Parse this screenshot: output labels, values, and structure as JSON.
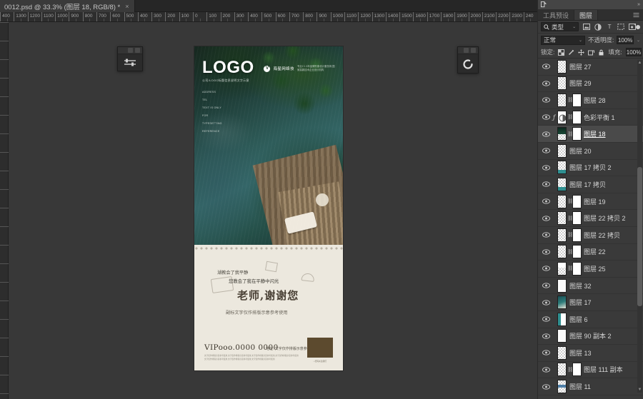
{
  "window": {
    "document_tab": {
      "title": "0012.psd @ 33.3% (图层 18, RGB/8) *",
      "close_label": "×"
    }
  },
  "rulers": {
    "horizontal_labels": [
      "400",
      "1300",
      "1200",
      "1100",
      "1000",
      "900",
      "800",
      "700",
      "600",
      "500",
      "400",
      "300",
      "200",
      "100",
      "0",
      "100",
      "200",
      "300",
      "400",
      "500",
      "600",
      "700",
      "800",
      "900",
      "1000",
      "1100",
      "1200",
      "1300",
      "1400",
      "1500",
      "1600",
      "1700",
      "1800",
      "1900",
      "2000",
      "2100",
      "2200",
      "2300",
      "240"
    ]
  },
  "floating_panels": [
    {
      "name": "adjustments-mini-panel",
      "icon": "sliders-icon",
      "min_label": "▬",
      "close_label": "▣"
    },
    {
      "name": "loading-mini-panel",
      "icon": "spinner-icon",
      "min_label": "▬",
      "close_label": "▣"
    }
  ],
  "artboard": {
    "logo": "LOGO",
    "logo_subtitle": "公司/LOGO标题信息说明文字示意",
    "brand": {
      "mark": "V",
      "name": "海星网络技",
      "desc": "专业2 1 3年品牌形象设计服务商 国家高新技术企业设计机构"
    },
    "address_lines": [
      "ADDRESS",
      "TEL",
      "TEXT IS ONLY",
      "FOR",
      "TYPESETTING",
      "REFERENCE"
    ],
    "card": {
      "line1": "湖教会了我平静",
      "line2": "您教会了我在平静中闪光",
      "headline": "老师,谢谢您",
      "subline": "副标文字仅作排版示意参考使用",
      "vip": "VIPooo.0000 0000",
      "vip_right": "地址: 文字仅作排版示意参考使用",
      "fine_print": "文字仅作排版示意参考使用,文字仅作排版示意参考使用,文字仅作排版示意参考使用,文字仅作排版示意参考使用 文字仅作排版示意参考使用,文字仅作排版示意参考使用,文字仅作排版示意参考使用",
      "swatch_label": "□扫码关注我们"
    }
  },
  "dock": {
    "collapse_icon": "chevron-double-right-icon",
    "tabs": [
      {
        "label": "工具预设",
        "active": false
      },
      {
        "label": "图层",
        "active": true
      }
    ],
    "panel_menu_icon": "hamburger-icon",
    "filter": {
      "search_icon": "search-icon",
      "kind_label": "类型",
      "caret": "⌄",
      "icons": [
        "pixel-layer-filter-icon",
        "adjustment-layer-filter-icon",
        "type-layer-filter-icon",
        "shape-layer-filter-icon",
        "smart-object-filter-icon"
      ],
      "toggle": "filter-enable-toggle"
    },
    "blend": {
      "mode": "正常",
      "caret": "⌄",
      "opacity_label": "不透明度:",
      "opacity_value": "100%"
    },
    "lock": {
      "label": "锁定:",
      "icons": [
        "lock-transparent-pixels-icon",
        "lock-image-pixels-icon",
        "lock-position-icon",
        "lock-artboard-nesting-icon",
        "lock-all-icon"
      ],
      "fill_label": "填充:",
      "fill_value": "100%"
    },
    "layers": [
      {
        "name": "图层 27",
        "visible": true,
        "selected": false,
        "has_mask": false,
        "has_fx": false,
        "thumb": "checker"
      },
      {
        "name": "图层 29",
        "visible": true,
        "selected": false,
        "has_mask": false,
        "has_fx": false,
        "thumb": "checker"
      },
      {
        "name": "图层 28",
        "visible": true,
        "selected": false,
        "has_mask": true,
        "has_fx": false,
        "thumb": "checker"
      },
      {
        "name": "色彩平衡 1",
        "visible": true,
        "selected": false,
        "has_mask": true,
        "has_fx": true,
        "thumb": "adjustment"
      },
      {
        "name": "图层 18",
        "visible": true,
        "selected": true,
        "has_mask": true,
        "has_fx": false,
        "thumb": "photo-dark"
      },
      {
        "name": "图层 20",
        "visible": true,
        "selected": false,
        "has_mask": false,
        "has_fx": false,
        "thumb": "checker"
      },
      {
        "name": "图层 17 拷贝 2",
        "visible": true,
        "selected": false,
        "has_mask": false,
        "has_fx": false,
        "thumb": "teal-bottom"
      },
      {
        "name": "图层 17 拷贝",
        "visible": true,
        "selected": false,
        "has_mask": false,
        "has_fx": false,
        "thumb": "teal-bottom"
      },
      {
        "name": "图层 19",
        "visible": true,
        "selected": false,
        "has_mask": true,
        "has_fx": false,
        "thumb": "checker"
      },
      {
        "name": "图层 22 拷贝 2",
        "visible": true,
        "selected": false,
        "has_mask": true,
        "has_fx": false,
        "thumb": "checker"
      },
      {
        "name": "图层 22 拷贝",
        "visible": true,
        "selected": false,
        "has_mask": true,
        "has_fx": false,
        "thumb": "checker"
      },
      {
        "name": "图层 22",
        "visible": true,
        "selected": false,
        "has_mask": true,
        "has_fx": false,
        "thumb": "checker"
      },
      {
        "name": "图层 25",
        "visible": true,
        "selected": false,
        "has_mask": true,
        "has_fx": false,
        "thumb": "white-top"
      },
      {
        "name": "图层 32",
        "visible": true,
        "selected": false,
        "has_mask": false,
        "has_fx": false,
        "thumb": "white-paper"
      },
      {
        "name": "图层 17",
        "visible": true,
        "selected": false,
        "has_mask": false,
        "has_fx": false,
        "thumb": "photo-teal"
      },
      {
        "name": "图层 6",
        "visible": true,
        "selected": false,
        "has_mask": false,
        "has_fx": false,
        "thumb": "teal-edge"
      },
      {
        "name": "图层 90 副本 2",
        "visible": true,
        "selected": false,
        "has_mask": false,
        "has_fx": false,
        "thumb": "white-paper"
      },
      {
        "name": "图层 13",
        "visible": true,
        "selected": false,
        "has_mask": false,
        "has_fx": false,
        "thumb": "checker"
      },
      {
        "name": "图层 111 副本",
        "visible": true,
        "selected": false,
        "has_mask": true,
        "has_fx": false,
        "thumb": "checker"
      },
      {
        "name": "图层 11",
        "visible": true,
        "selected": false,
        "has_mask": false,
        "has_fx": false,
        "thumb": "blue-line"
      }
    ]
  },
  "colors": {
    "app_background": "#3a3a3a",
    "panel_background": "#383838",
    "tab_background": "#262626",
    "selected_row": "#4a4a4a",
    "field_background": "#262626",
    "text": "#d6d6d6"
  }
}
